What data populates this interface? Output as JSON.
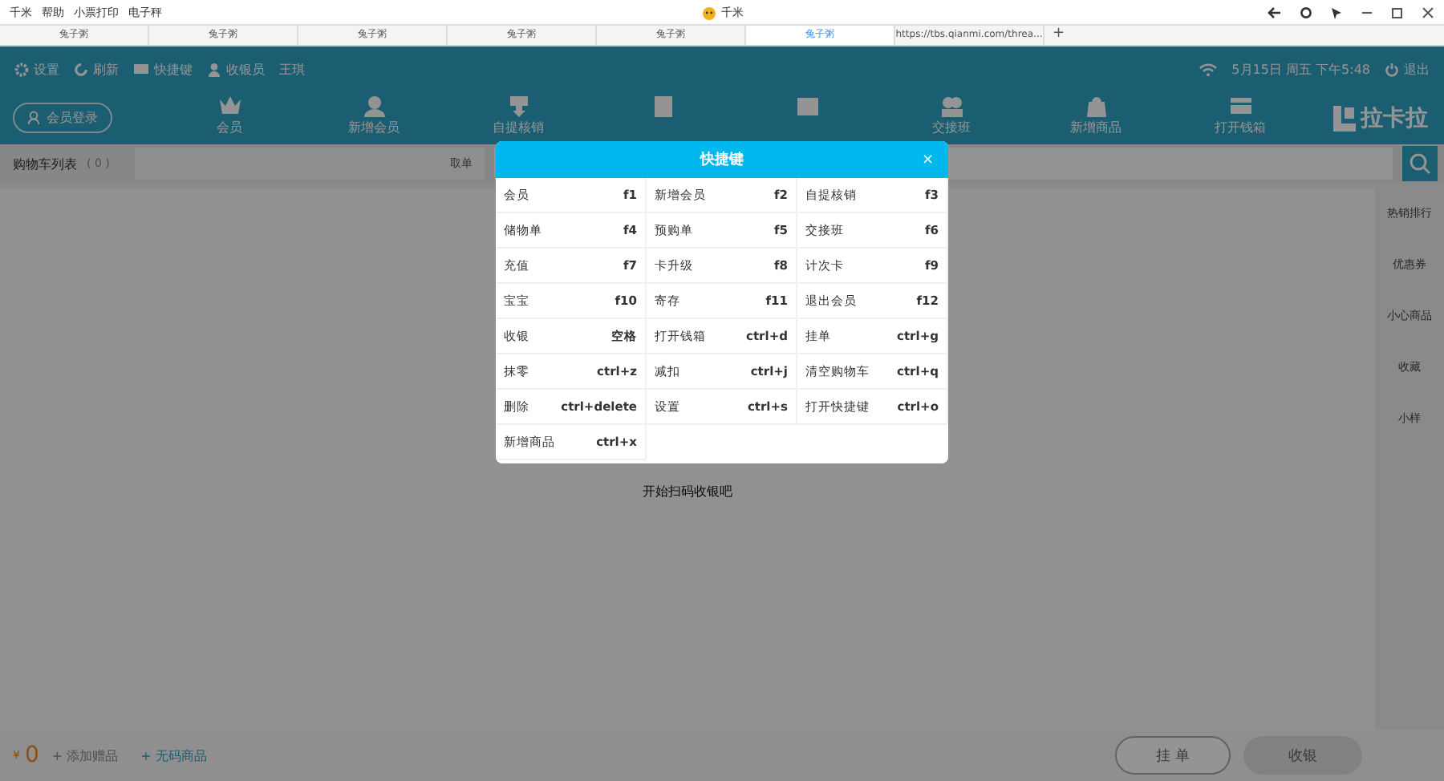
{
  "titlebar": {
    "menu": [
      "千米",
      "帮助",
      "小票打印",
      "电子秤"
    ],
    "title": "千米"
  },
  "tabs": [
    {
      "label": "兔子粥",
      "selected": false
    },
    {
      "label": "兔子粥",
      "selected": false
    },
    {
      "label": "兔子粥",
      "selected": false
    },
    {
      "label": "兔子粥",
      "selected": false
    },
    {
      "label": "兔子粥",
      "selected": false
    },
    {
      "label": "兔子粥",
      "selected": true
    },
    {
      "label": "https://tbs.qianmi.com/threa...",
      "selected": false
    }
  ],
  "new_tab": "+",
  "toolbar": {
    "items": [
      "设置",
      "刷新",
      "快捷键",
      "收银员"
    ],
    "cashier": "王琪",
    "datetime": "5月15日 周五 下午5:48",
    "logout": "退出"
  },
  "member_login": "会员登录",
  "nav": [
    {
      "kind": "labeled",
      "label": "会员"
    },
    {
      "kind": "labeled",
      "label": "新增会员"
    },
    {
      "kind": "labeled",
      "label": "自提核销"
    },
    {
      "kind": "icon"
    },
    {
      "kind": "icon"
    },
    {
      "kind": "labeled",
      "label": "交接班"
    },
    {
      "kind": "labeled",
      "label": "新增商品"
    },
    {
      "kind": "labeled",
      "label": "打开钱箱"
    }
  ],
  "brand": "拉卡拉",
  "cart": {
    "title": "购物车列表",
    "count": "( 0 )",
    "take_order": "取单",
    "empty": "开始扫码收银吧"
  },
  "sidebar": [
    "热销排行",
    "优惠券",
    "小心商品",
    "收藏",
    "小样"
  ],
  "footer": {
    "currency": "¥",
    "total": "0",
    "add_gift": "+ 添加赠品",
    "no_code": "+ 无码商品",
    "hold": "挂 单",
    "checkout": "收银",
    "checkout_disabled": true
  },
  "dialog": {
    "title": "快捷键",
    "close": "×",
    "shortcuts": [
      {
        "action": "会员",
        "key": "f1"
      },
      {
        "action": "新增会员",
        "key": "f2"
      },
      {
        "action": "自提核销",
        "key": "f3"
      },
      {
        "action": "储物单",
        "key": "f4"
      },
      {
        "action": "预购单",
        "key": "f5"
      },
      {
        "action": "交接班",
        "key": "f6"
      },
      {
        "action": "充值",
        "key": "f7"
      },
      {
        "action": "卡升级",
        "key": "f8"
      },
      {
        "action": "计次卡",
        "key": "f9"
      },
      {
        "action": "宝宝",
        "key": "f10"
      },
      {
        "action": "寄存",
        "key": "f11"
      },
      {
        "action": "退出会员",
        "key": "f12"
      },
      {
        "action": "收银",
        "key": "空格"
      },
      {
        "action": "打开钱箱",
        "key": "ctrl+d"
      },
      {
        "action": "挂单",
        "key": "ctrl+g"
      },
      {
        "action": "抹零",
        "key": "ctrl+z"
      },
      {
        "action": "减扣",
        "key": "ctrl+j"
      },
      {
        "action": "清空购物车",
        "key": "ctrl+q"
      },
      {
        "action": "删除",
        "key": "ctrl+delete"
      },
      {
        "action": "设置",
        "key": "ctrl+s"
      },
      {
        "action": "打开快捷键",
        "key": "ctrl+o"
      },
      {
        "action": "新增商品",
        "key": "ctrl+x"
      }
    ]
  }
}
